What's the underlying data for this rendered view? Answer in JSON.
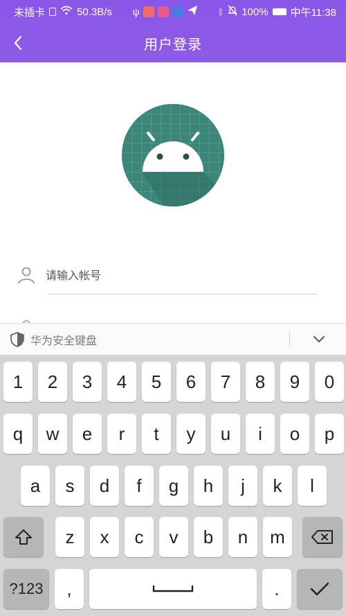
{
  "status_bar": {
    "carrier": "未插卡",
    "net_speed": "50.3B/s",
    "battery": "100%",
    "time": "中午11:38"
  },
  "navbar": {
    "title": "用户登录",
    "back_icon": "chevron-left-icon"
  },
  "logo": {
    "icon": "android-robot-icon",
    "color": "#3c8579"
  },
  "login_form": {
    "account": {
      "placeholder": "请输入帐号",
      "icon": "user-icon"
    }
  },
  "keyboard_bar": {
    "label": "华为安全键盘",
    "shield_icon": "shield-icon",
    "collapse_icon": "chevron-down-icon"
  },
  "keyboard": {
    "row_numbers": [
      "1",
      "2",
      "3",
      "4",
      "5",
      "6",
      "7",
      "8",
      "9",
      "0"
    ],
    "row_top": [
      "q",
      "w",
      "e",
      "r",
      "t",
      "y",
      "u",
      "i",
      "o",
      "p"
    ],
    "row_middle": [
      "a",
      "s",
      "d",
      "f",
      "g",
      "h",
      "j",
      "k",
      "l"
    ],
    "row_bottom": [
      "z",
      "x",
      "c",
      "v",
      "b",
      "n",
      "m"
    ],
    "shift_icon": "shift-icon",
    "backspace_icon": "backspace-icon",
    "mode_label": "?123",
    "comma_label": ",",
    "period_label": ".",
    "space_icon": "space-icon",
    "enter_icon": "checkmark-icon"
  },
  "colors": {
    "header": "#8a56e8",
    "logo_bg": "#3c8579",
    "keyboard_bg": "#d5d5d7",
    "key_bg": "#ffffff",
    "special_key_bg": "#b5b6ba"
  }
}
